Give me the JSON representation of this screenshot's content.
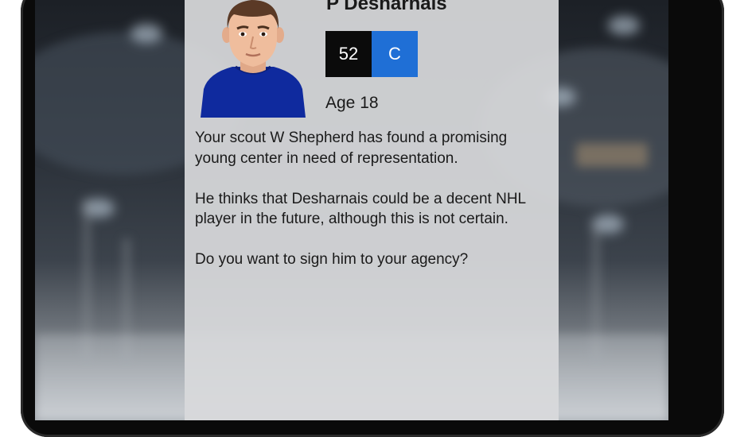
{
  "player": {
    "name": "P Desharnais",
    "rating": "52",
    "position": "C",
    "age_label": "Age 18"
  },
  "scout_report": {
    "paragraph_1": "Your scout W Shepherd has found a promising young center in need of representation.",
    "paragraph_2": "He thinks that Desharnais could be a decent NHL player in the future, although this is not certain.",
    "question": "Do you want to sign him to your agency?"
  },
  "colors": {
    "rating_bg": "#0b0b0b",
    "position_bg": "#1f6fd6",
    "panel_bg": "#d8d9dc",
    "jersey": "#0f2a9e"
  },
  "icons": {
    "avatar": "player-avatar-icon"
  }
}
